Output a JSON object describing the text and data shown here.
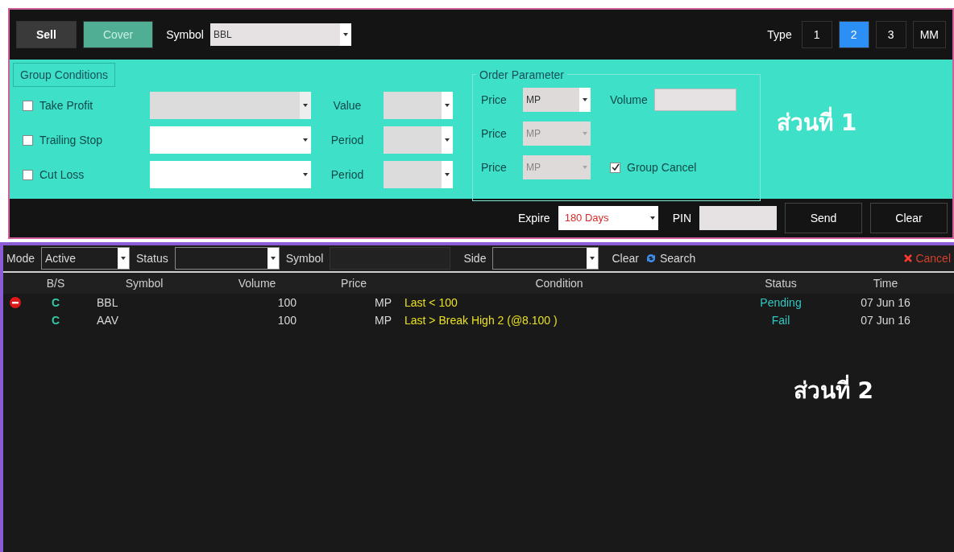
{
  "toolbar": {
    "side_buttons": [
      {
        "label": "Sell",
        "selected": false
      },
      {
        "label": "Cover",
        "selected": true
      }
    ],
    "symbol_label": "Symbol",
    "symbol_value": "BBL",
    "type_label": "Type",
    "types": [
      {
        "label": "1",
        "selected": false
      },
      {
        "label": "2",
        "selected": true
      },
      {
        "label": "3",
        "selected": false
      },
      {
        "label": "MM",
        "selected": false
      }
    ]
  },
  "group_conditions": {
    "title": "Group Conditions",
    "rows": [
      {
        "label": "Take Profit",
        "checked": false,
        "disabled": true,
        "param_label": "Value"
      },
      {
        "label": "Trailing Stop",
        "checked": false,
        "disabled": false,
        "param_label": "Period"
      },
      {
        "label": "Cut Loss",
        "checked": false,
        "disabled": false,
        "param_label": "Period"
      }
    ]
  },
  "order_parameter": {
    "title": "Order Parameter",
    "prices": [
      {
        "label": "Price",
        "value": "MP",
        "disabled": false
      },
      {
        "label": "Price",
        "value": "MP",
        "disabled": true
      },
      {
        "label": "Price",
        "value": "MP",
        "disabled": true
      }
    ],
    "volume_label": "Volume",
    "group_cancel": {
      "label": "Group Cancel",
      "checked": true
    }
  },
  "section_1_label": "ส่วนที่ 1",
  "order_bar": {
    "expire_label": "Expire",
    "expire_value": "180 Days",
    "pin_label": "PIN",
    "buttons": [
      "Send",
      "Clear"
    ]
  },
  "filter_bar": {
    "mode_label": "Mode",
    "mode_value": "Active",
    "status_label": "Status",
    "symbol_label": "Symbol",
    "side_label": "Side",
    "clear": "Clear",
    "search": "Search",
    "cancel": "Cancel"
  },
  "table": {
    "columns": [
      "B/S",
      "Symbol",
      "Volume",
      "Price",
      "Condition",
      "Status",
      "Time"
    ],
    "rows": [
      {
        "marked": true,
        "cells": [
          "C",
          "BBL",
          "100",
          "MP",
          "Last < 100",
          "Pending",
          "07 Jun 16"
        ]
      },
      {
        "marked": false,
        "cells": [
          "C",
          "AAV",
          "100",
          "MP",
          "Last > Break High 2 (@8.100 )",
          "Fail",
          "07 Jun 16"
        ]
      }
    ]
  },
  "section_2_label": "ส่วนที่ 2"
}
